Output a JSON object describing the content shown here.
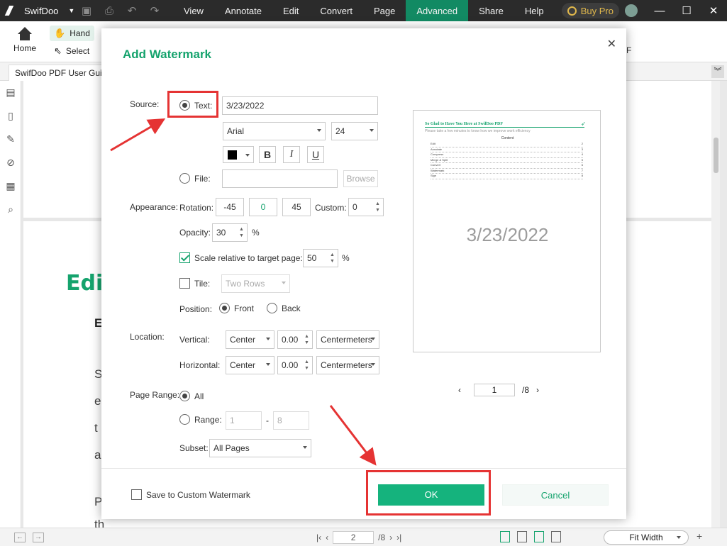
{
  "app": {
    "name": "SwifDoo",
    "menu": [
      "View",
      "Annotate",
      "Edit",
      "Convert",
      "Page",
      "Advanced",
      "Share",
      "Help"
    ],
    "active_menu": "Advanced",
    "buy_pro": "Buy Pro"
  },
  "ribbon": {
    "home": "Home",
    "hand": "Hand",
    "select": "Select",
    "right_fragment": "F"
  },
  "tabs": {
    "doc_tab": "SwifDoo PDF User Guide"
  },
  "document": {
    "heading": "Edit",
    "subheading": "E",
    "lines": [
      "S",
      "e",
      "t",
      "a",
      "P",
      "th"
    ]
  },
  "statusbar": {
    "page": "2",
    "total": "/8",
    "zoom": "Fit Width"
  },
  "dialog": {
    "title": "Add Watermark",
    "source_label": "Source:",
    "text_label": "Text:",
    "text_value": "3/23/2022",
    "font": "Arial",
    "font_size": "24",
    "bold": "B",
    "italic": "I",
    "underline": "U",
    "file_label": "File:",
    "browse": "Browse",
    "appearance_label": "Appearance:",
    "rotation_label": "Rotation:",
    "rotation_presets": [
      "-45",
      "0",
      "45"
    ],
    "custom_label": "Custom:",
    "custom_value": "0",
    "opacity_label": "Opacity:",
    "opacity_value": "30",
    "percent": "%",
    "scale_label": "Scale relative to target page:",
    "scale_value": "50",
    "tile_label": "Tile:",
    "tile_value": "Two Rows",
    "position_label": "Position:",
    "front": "Front",
    "back": "Back",
    "location_label": "Location:",
    "vertical_label": "Vertical:",
    "vertical_align": "Center",
    "vertical_offset": "0.00",
    "vertical_unit": "Centermeters",
    "horizontal_label": "Horizontal:",
    "horizontal_align": "Center",
    "horizontal_offset": "0.00",
    "horizontal_unit": "Centermeters",
    "page_range_label": "Page Range:",
    "all_label": "All",
    "range_label": "Range:",
    "range_from": "1",
    "range_dash": "-",
    "range_to": "8",
    "subset_label": "Subset:",
    "subset_value": "All Pages",
    "save_custom": "Save to Custom Watermark",
    "ok": "OK",
    "cancel": "Cancel"
  },
  "preview": {
    "doc_title": "So Glad to Have You Here at SwifDoo PDF",
    "doc_sub": "Please take a few minutes to know how we improve work efficiency",
    "contents": "Content",
    "toc": [
      {
        "item": "Edit",
        "page": "2"
      },
      {
        "item": "Annotate",
        "page": "3"
      },
      {
        "item": "Compress",
        "page": "4"
      },
      {
        "item": "Merge & Split",
        "page": "5"
      },
      {
        "item": "Convert",
        "page": "6"
      },
      {
        "item": "Watermark",
        "page": "7"
      },
      {
        "item": "Sign",
        "page": "8"
      }
    ],
    "watermark_text": "3/23/2022",
    "page": "1",
    "total": "/8"
  },
  "colors": {
    "accent": "#15a36d",
    "menubar": "#2b2b2b",
    "highlight": "#e53333",
    "watermark_color": "#000000"
  }
}
